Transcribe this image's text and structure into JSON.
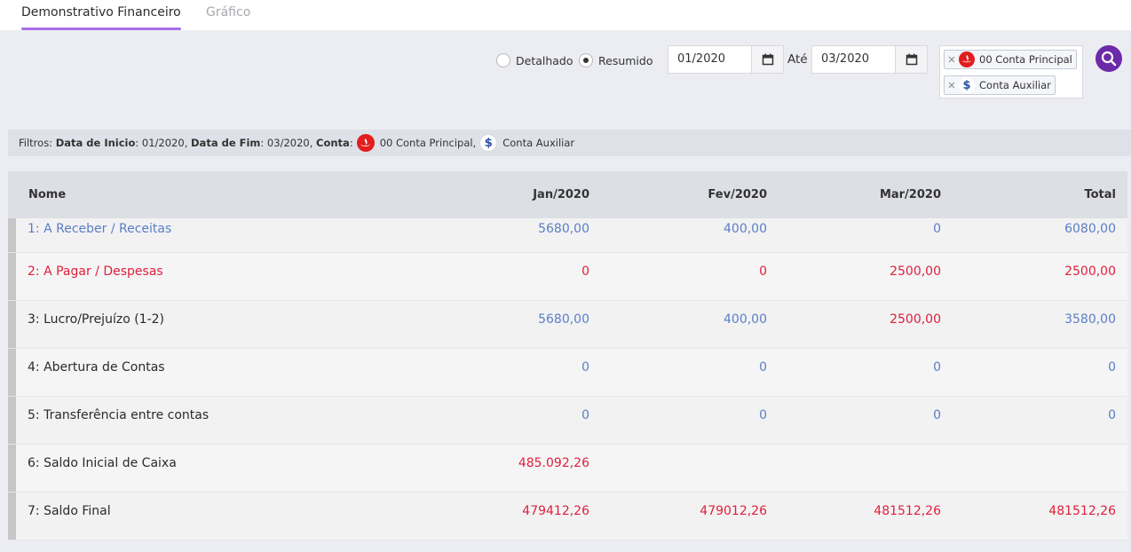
{
  "tabs": [
    {
      "label": "Demonstrativo Financeiro",
      "active": true
    },
    {
      "label": "Gráfico",
      "active": false
    }
  ],
  "view_mode": {
    "options": [
      "Detalhado",
      "Resumido"
    ],
    "selected": "Resumido"
  },
  "period": {
    "start": "01/2020",
    "separator": "Até",
    "end": "03/2020"
  },
  "accounts": [
    {
      "label": "00 Conta Principal",
      "icon": "santander-logo"
    },
    {
      "label": "Conta Auxiliar",
      "icon": "dollar-icon"
    }
  ],
  "filters": {
    "prefix": "Filtros:",
    "start_label": "Data de Inicio",
    "start_value": ": 01/2020,",
    "end_label": "Data de Fim",
    "end_value": ": 03/2020,",
    "account_label": "Conta",
    "account_sep": ":",
    "account1": "00 Conta Principal,",
    "account2": "Conta Auxiliar"
  },
  "table": {
    "headers": [
      "Nome",
      "Jan/2020",
      "Fev/2020",
      "Mar/2020",
      "Total"
    ],
    "rows": [
      {
        "name": "1: A Receber / Receitas",
        "jan": "5680,00",
        "fev": "400,00",
        "mar": "0",
        "total": "6080,00"
      },
      {
        "name": "2: A Pagar / Despesas",
        "jan": "0",
        "fev": "0",
        "mar": "2500,00",
        "total": "2500,00"
      },
      {
        "name": "3: Lucro/Prejuízo (1-2)",
        "jan": "5680,00",
        "fev": "400,00",
        "mar": "2500,00",
        "total": "3580,00"
      },
      {
        "name": "4: Abertura de Contas",
        "jan": "0",
        "fev": "0",
        "mar": "0",
        "total": "0"
      },
      {
        "name": "5: Transferência entre contas",
        "jan": "0",
        "fev": "0",
        "mar": "0",
        "total": "0"
      },
      {
        "name": "6: Saldo Inicial de Caixa",
        "jan": "485.092,26",
        "fev": "",
        "mar": "",
        "total": ""
      },
      {
        "name": "7: Saldo Final",
        "jan": "479412,26",
        "fev": "479012,26",
        "mar": "481512,26",
        "total": "481512,26"
      }
    ]
  },
  "colors": {
    "accent": "#a66ee6",
    "search_button": "#6c2aa8",
    "positive": "#5b7ec4",
    "negative": "#e0203a"
  }
}
